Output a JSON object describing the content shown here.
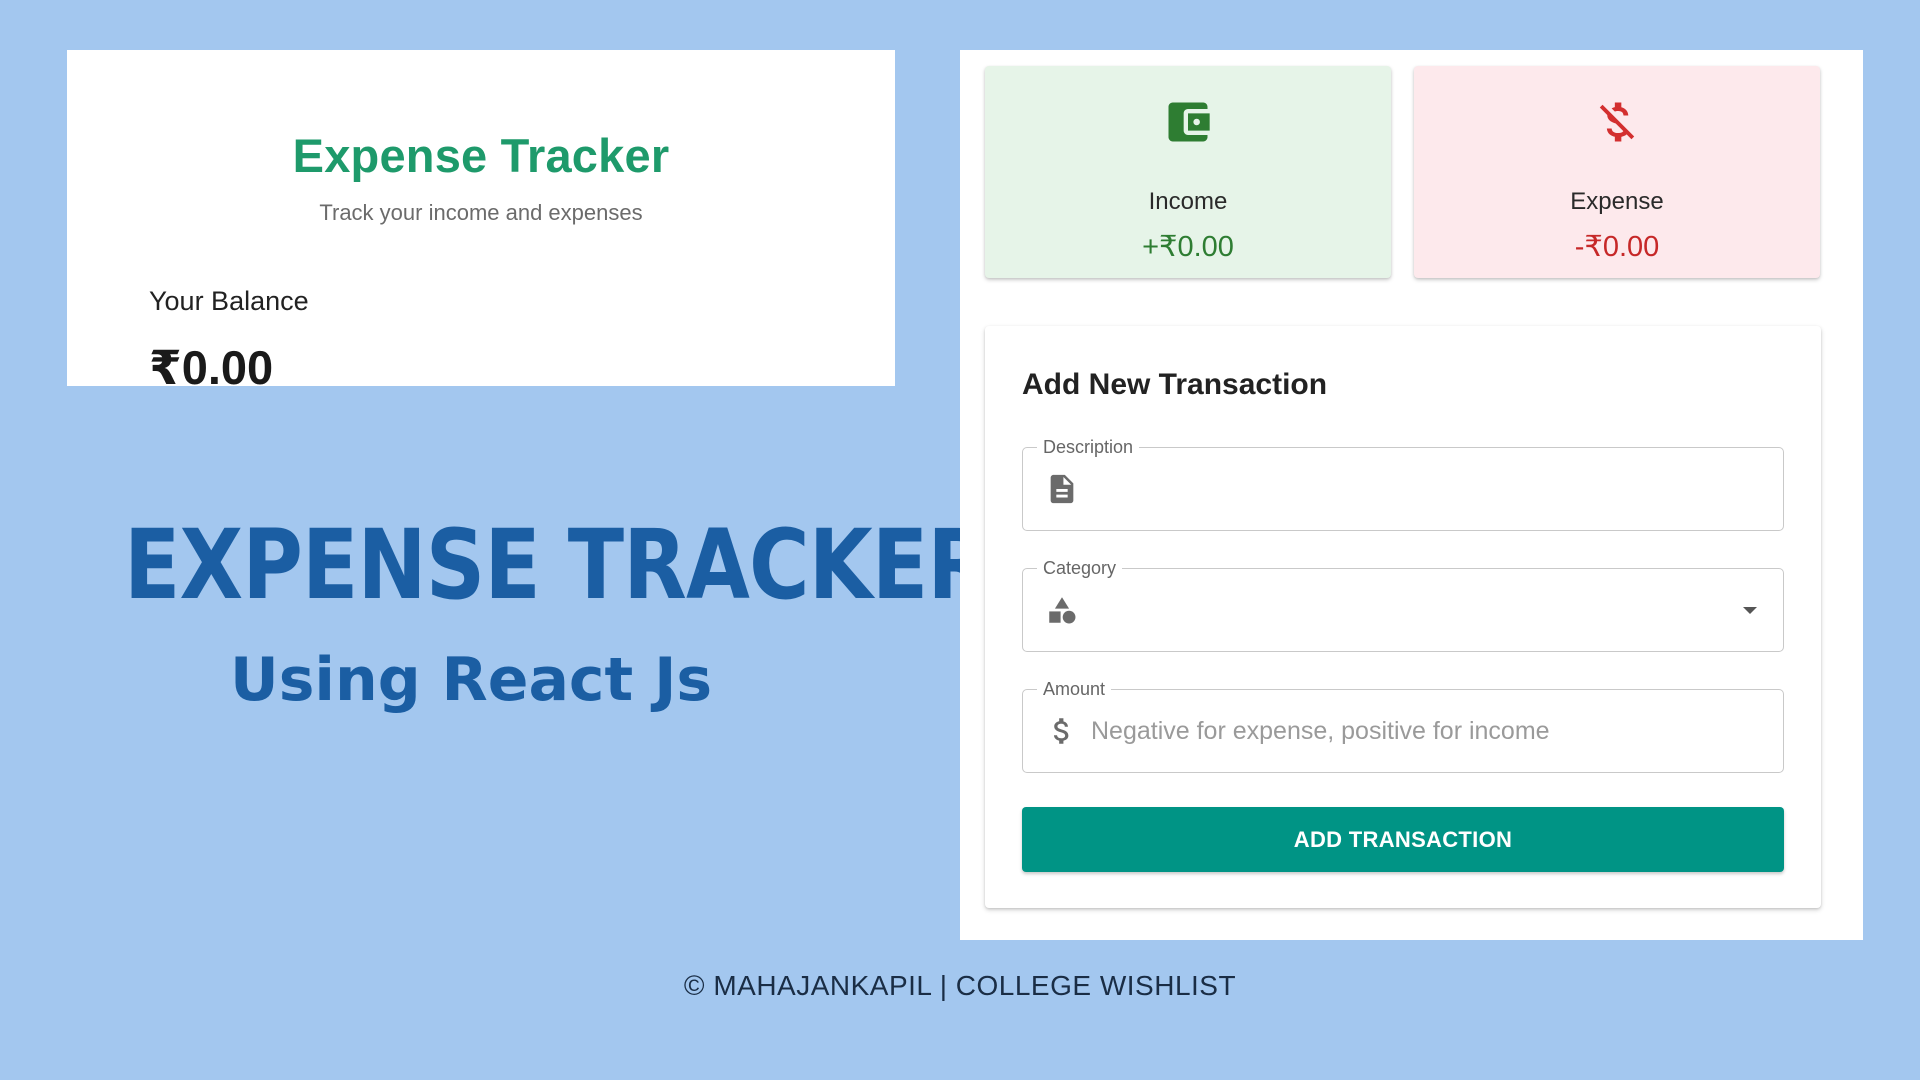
{
  "app": {
    "title": "Expense Tracker",
    "subtitle": "Track your income and expenses",
    "balance_label": "Your Balance",
    "balance_value": "₹0.00"
  },
  "promo": {
    "title": "EXPENSE TRACKER",
    "subtitle": "Using React Js"
  },
  "summary": {
    "income": {
      "label": "Income",
      "value": "+₹0.00",
      "icon": "wallet-icon",
      "color": "#2e7d32"
    },
    "expense": {
      "label": "Expense",
      "value": "-₹0.00",
      "icon": "money-off-icon",
      "color": "#c62828"
    }
  },
  "form": {
    "title": "Add New Transaction",
    "description": {
      "label": "Description",
      "value": "",
      "icon": "document-icon"
    },
    "category": {
      "label": "Category",
      "value": "",
      "icon": "category-shapes-icon"
    },
    "amount": {
      "label": "Amount",
      "value": "",
      "placeholder": "Negative for expense, positive for income",
      "icon": "dollar-icon"
    },
    "submit_label": "ADD TRANSACTION",
    "button_color": "#009485"
  },
  "footer": {
    "text": "© MAHAJANKAPIL | COLLEGE WISHLIST"
  },
  "colors": {
    "background": "#a3c7ef",
    "title_green": "#1e9a6b",
    "promo_blue": "#1b5ea3"
  }
}
